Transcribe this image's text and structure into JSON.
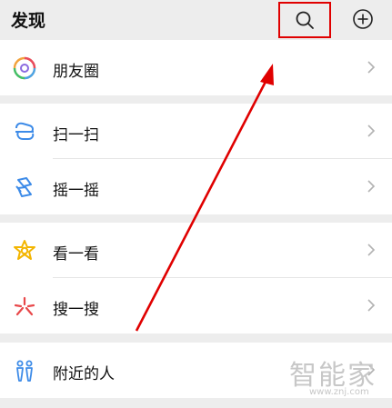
{
  "header": {
    "title": "发现",
    "search_icon": "search-icon",
    "add_icon": "plus-circle-icon"
  },
  "groups": [
    {
      "items": [
        {
          "label": "朋友圈",
          "icon": "moments-icon"
        }
      ]
    },
    {
      "items": [
        {
          "label": "扫一扫",
          "icon": "scan-icon"
        },
        {
          "label": "摇一摇",
          "icon": "shake-icon"
        }
      ]
    },
    {
      "items": [
        {
          "label": "看一看",
          "icon": "top-stories-icon"
        },
        {
          "label": "搜一搜",
          "icon": "search-sparkle-icon"
        }
      ]
    },
    {
      "items": [
        {
          "label": "附近的人",
          "icon": "people-nearby-icon"
        }
      ]
    }
  ],
  "annotation": {
    "highlight_color": "#e00000"
  },
  "watermark": {
    "text": "智能家",
    "url": "www.znj.com"
  }
}
